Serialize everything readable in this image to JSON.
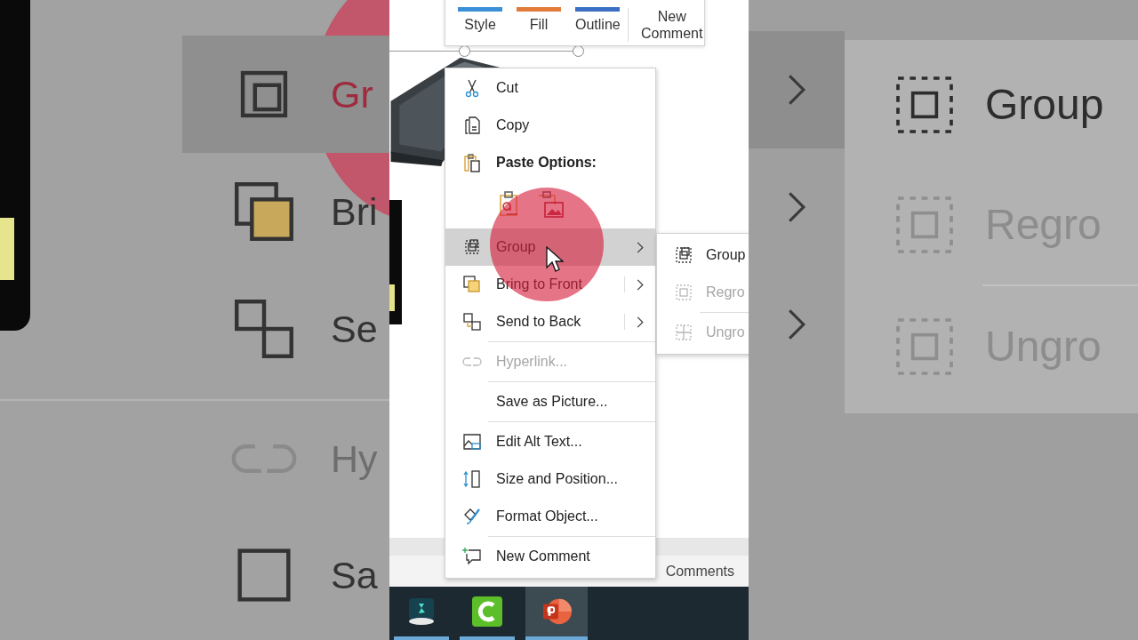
{
  "zoom_left": {
    "items": [
      {
        "label": "Gr",
        "selected": true,
        "disabled": false
      },
      {
        "label": "Bri",
        "selected": false,
        "disabled": false
      },
      {
        "label": "Se",
        "selected": false,
        "disabled": false
      },
      {
        "label": "Hy",
        "selected": false,
        "disabled": true
      },
      {
        "label": "Sa",
        "selected": false,
        "disabled": false
      }
    ]
  },
  "zoom_right": {
    "items": [
      {
        "label": "Group",
        "disabled": false
      },
      {
        "label": "Regro",
        "disabled": true
      },
      {
        "label": "Ungro",
        "disabled": true
      }
    ]
  },
  "mini_toolbar": {
    "buttons": [
      {
        "label": "Style",
        "color": "#3b8fd6"
      },
      {
        "label": "Fill",
        "color": "#e07b39"
      },
      {
        "label": "Outline",
        "color": "#3a6fc4"
      },
      {
        "label": "New Comment"
      }
    ]
  },
  "context_menu": {
    "items": [
      {
        "kind": "command",
        "label": "Cut",
        "disabled": false,
        "selected": false,
        "submenu": false,
        "divider_before": false
      },
      {
        "kind": "command",
        "label": "Copy",
        "disabled": false,
        "selected": false,
        "submenu": false,
        "divider_before": false
      },
      {
        "kind": "header",
        "label": "Paste Options:"
      },
      {
        "kind": "paste_options"
      },
      {
        "kind": "command",
        "label": "Group",
        "disabled": false,
        "selected": true,
        "submenu": true,
        "divider_before": false
      },
      {
        "kind": "command",
        "label": "Bring to Front",
        "disabled": false,
        "selected": false,
        "submenu": true,
        "divider_before": false
      },
      {
        "kind": "command",
        "label": "Send to Back",
        "disabled": false,
        "selected": false,
        "submenu": true,
        "divider_before": false
      },
      {
        "kind": "command",
        "label": "Hyperlink...",
        "disabled": true,
        "selected": false,
        "submenu": false,
        "divider_before": true
      },
      {
        "kind": "command",
        "label": "Save as Picture...",
        "disabled": false,
        "selected": false,
        "submenu": false,
        "divider_before": true
      },
      {
        "kind": "command",
        "label": "Edit Alt Text...",
        "disabled": false,
        "selected": false,
        "submenu": false,
        "divider_before": true
      },
      {
        "kind": "command",
        "label": "Size and Position...",
        "disabled": false,
        "selected": false,
        "submenu": false,
        "divider_before": false
      },
      {
        "kind": "command",
        "label": "Format Object...",
        "disabled": false,
        "selected": false,
        "submenu": false,
        "divider_before": false
      },
      {
        "kind": "command",
        "label": "New Comment",
        "disabled": false,
        "selected": false,
        "submenu": false,
        "divider_before": true
      }
    ]
  },
  "submenu": {
    "items": [
      {
        "label": "Group",
        "disabled": false,
        "divider_before": false
      },
      {
        "label": "Regro",
        "disabled": true,
        "divider_before": false
      },
      {
        "label": "Ungro",
        "disabled": true,
        "divider_before": true
      }
    ]
  },
  "status_bar": {
    "label": "Comments"
  },
  "taskbar": {
    "apps": [
      {
        "selected": false
      },
      {
        "selected": false
      },
      {
        "selected": true
      }
    ]
  }
}
